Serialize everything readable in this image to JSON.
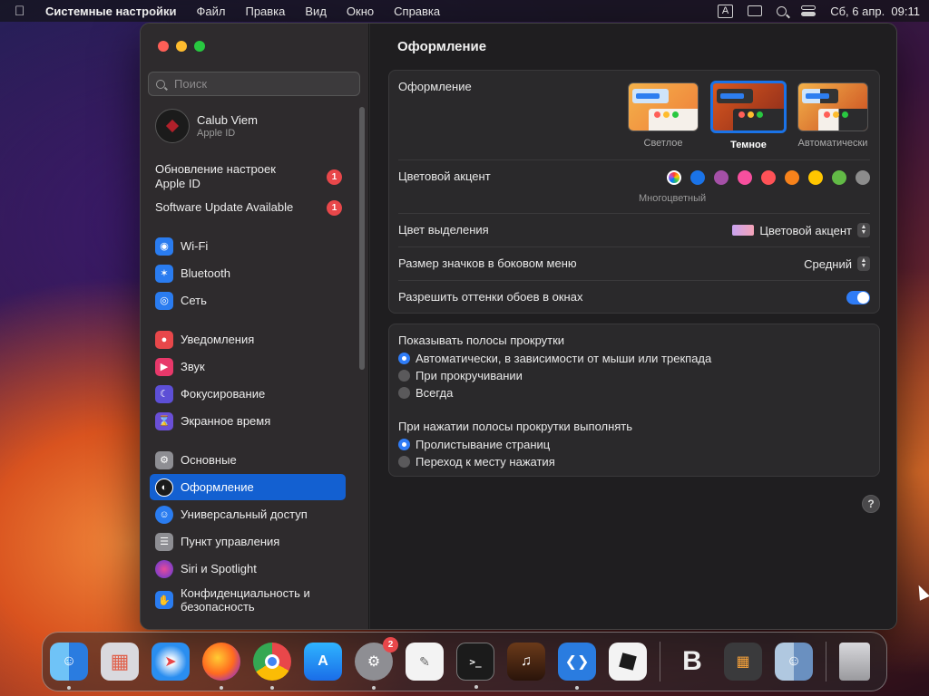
{
  "menubar": {
    "app_name": "Системные настройки",
    "items": [
      "Файл",
      "Правка",
      "Вид",
      "Окно",
      "Справка"
    ],
    "input_indicator": "A",
    "datetime": "Сб, 6 апр.  09:11"
  },
  "sidebar": {
    "search_placeholder": "Поиск",
    "profile": {
      "name": "Calub Viem",
      "subtitle": "Apple ID"
    },
    "updates": [
      {
        "label": "Обновление настроек Apple ID",
        "badge": "1"
      },
      {
        "label": "Software Update Available",
        "badge": "1"
      }
    ],
    "items": [
      {
        "label": "Wi-Fi",
        "icon": "wifi-icon",
        "color": "#2a7cf0"
      },
      {
        "label": "Bluetooth",
        "icon": "bluetooth-icon",
        "color": "#2a7cf0"
      },
      {
        "label": "Сеть",
        "icon": "globe-icon",
        "color": "#2a7cf0"
      },
      {
        "label": "Уведомления",
        "icon": "bell-icon",
        "color": "#e8474a"
      },
      {
        "label": "Звук",
        "icon": "speaker-icon",
        "color": "#e8386a"
      },
      {
        "label": "Фокусирование",
        "icon": "moon-icon",
        "color": "#5d4fd6"
      },
      {
        "label": "Экранное время",
        "icon": "hourglass-icon",
        "color": "#6a4fd6"
      },
      {
        "label": "Основные",
        "icon": "gear-icon",
        "color": "#8e8e93"
      },
      {
        "label": "Оформление",
        "icon": "appearance-icon",
        "color": "#1b1b1b"
      },
      {
        "label": "Универсальный доступ",
        "icon": "accessibility-icon",
        "color": "#2a7cf0"
      },
      {
        "label": "Пункт управления",
        "icon": "control-center-icon",
        "color": "#8e8e93"
      },
      {
        "label": "Siri и Spotlight",
        "icon": "siri-icon",
        "color": "#b04fd6"
      },
      {
        "label": "Конфиденциальность и безопасность",
        "icon": "hand-icon",
        "color": "#2a7cf0"
      }
    ],
    "selected": "Оформление"
  },
  "content": {
    "title": "Оформление",
    "appearance": {
      "label": "Оформление",
      "options": [
        "Светлое",
        "Темное",
        "Автоматически"
      ],
      "selected": "Темное"
    },
    "accent": {
      "label": "Цветовой акцент",
      "selected_caption": "Многоцветный",
      "colors": [
        "multicolor",
        "#1a73e8",
        "#a550a7",
        "#f74f9e",
        "#ff5257",
        "#f7821b",
        "#ffc600",
        "#62ba46",
        "#8c8c8c"
      ]
    },
    "highlight": {
      "label": "Цвет выделения",
      "value": "Цветовой акцент"
    },
    "sidebar_icon_size": {
      "label": "Размер значков в боковом меню",
      "value": "Средний"
    },
    "wallpaper_tinting": {
      "label": "Разрешить оттенки обоев в окнах",
      "on": true
    },
    "scrollbars": {
      "label": "Показывать полосы прокрутки",
      "options": [
        "Автоматически, в зависимости от мыши или трекпада",
        "При прокручивании",
        "Всегда"
      ],
      "selected": 0
    },
    "click_scroll": {
      "label": "При нажатии полосы прокрутки выполнять",
      "options": [
        "Пролистывание страниц",
        "Переход к месту нажатия"
      ],
      "selected": 0
    },
    "help": "?"
  },
  "dock": {
    "calendar_badge": "2"
  }
}
